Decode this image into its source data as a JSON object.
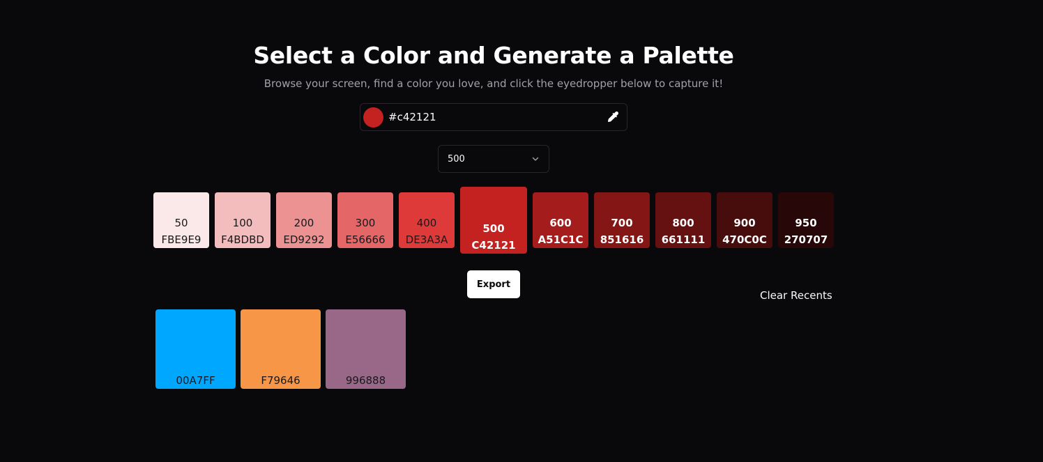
{
  "header": {
    "title": "Select a Color and Generate a Palette",
    "subtitle": "Browse your screen, find a color you love, and click the eyedropper below to capture it!"
  },
  "color_input": {
    "value": "#c42121",
    "swatch_color": "#c42121",
    "icon": "eyedropper-icon"
  },
  "shade_select": {
    "selected": "500",
    "icon": "chevron-down-icon"
  },
  "palette": [
    {
      "num": "50",
      "code": "FBE9E9",
      "color": "#fbe9e9",
      "text": "#18181b"
    },
    {
      "num": "100",
      "code": "F4BDBD",
      "color": "#f4bdbd",
      "text": "#18181b"
    },
    {
      "num": "200",
      "code": "ED9292",
      "color": "#ed9292",
      "text": "#18181b"
    },
    {
      "num": "300",
      "code": "E56666",
      "color": "#e56666",
      "text": "#18181b"
    },
    {
      "num": "400",
      "code": "DE3A3A",
      "color": "#de3a3a",
      "text": "#18181b"
    },
    {
      "num": "500",
      "code": "C42121",
      "color": "#c42121",
      "text": "#ffffff",
      "selected": true
    },
    {
      "num": "600",
      "code": "A51C1C",
      "color": "#a51c1c",
      "text": "#ffffff"
    },
    {
      "num": "700",
      "code": "851616",
      "color": "#851616",
      "text": "#ffffff"
    },
    {
      "num": "800",
      "code": "661111",
      "color": "#661111",
      "text": "#ffffff"
    },
    {
      "num": "900",
      "code": "470C0C",
      "color": "#470c0c",
      "text": "#ffffff"
    },
    {
      "num": "950",
      "code": "270707",
      "color": "#270707",
      "text": "#ffffff"
    }
  ],
  "actions": {
    "export_label": "Export",
    "clear_recents_label": "Clear Recents"
  },
  "recents": [
    {
      "code": "00A7FF",
      "color": "#00a7ff"
    },
    {
      "code": "F79646",
      "color": "#f79646"
    },
    {
      "code": "996888",
      "color": "#996888"
    }
  ]
}
